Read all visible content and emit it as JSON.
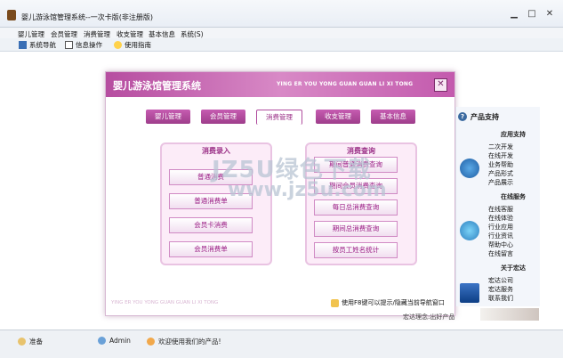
{
  "window": {
    "title": "婴儿游泳馆管理系统--一次卡版(非注册版)",
    "controls": {
      "min": "▁",
      "max": "□",
      "close": "✕"
    }
  },
  "menu": [
    "婴儿管理",
    "会员管理",
    "消费管理",
    "收支管理",
    "基本信息",
    "系统(S)"
  ],
  "toolbar": [
    {
      "label": "系统导航",
      "icon": "navigation-icon"
    },
    {
      "label": "信息操作",
      "icon": "checkbox-icon"
    },
    {
      "label": "使用指南",
      "icon": "help-icon"
    }
  ],
  "dialog": {
    "title_cn": "婴儿游泳馆管理系统",
    "title_en": "YING ER YOU YONG GUAN GUAN LI XI TONG",
    "tabs": [
      "婴儿管理",
      "会员管理",
      "消费管理",
      "收支管理",
      "基本信息"
    ],
    "active_tab": 2,
    "left_panel": {
      "title": "消费录入",
      "buttons": [
        "普通消费",
        "普通消费单",
        "会员卡消费",
        "会员消费单"
      ]
    },
    "right_panel": {
      "title": "消费查询",
      "buttons": [
        "期间普通消费查询",
        "期间会员消费查询",
        "每日总消费查询",
        "期间总消费查询",
        "按员工姓名统计"
      ]
    },
    "footer_en": "YING ER YOU YONG GUAN GUAN LI XI TONG",
    "footer_tip": "使用F8键可以提示/隐藏当前导航窗口"
  },
  "sidebar": {
    "header": "产品支持",
    "sections": [
      {
        "title": "应用支持",
        "items": [
          "二次开发",
          "在线开发",
          "业务帮助",
          "产品形式",
          "产品展示"
        ]
      },
      {
        "title": "在线服务",
        "items": [
          "在线客服",
          "在线体验",
          "行业应用",
          "行业资讯",
          "帮助中心",
          "在线留言"
        ]
      },
      {
        "title": "关于宏达",
        "items": [
          "宏达公司",
          "宏达服务",
          "联系我们"
        ]
      }
    ]
  },
  "footer_company": "宏达理念:出好产品",
  "watermark": {
    "line1": "JZ5U绿色下载",
    "line2": "www.jz5u.com"
  },
  "status": {
    "state": "准备",
    "user": "Admin",
    "message": "欢迎使用我们的产品!"
  }
}
